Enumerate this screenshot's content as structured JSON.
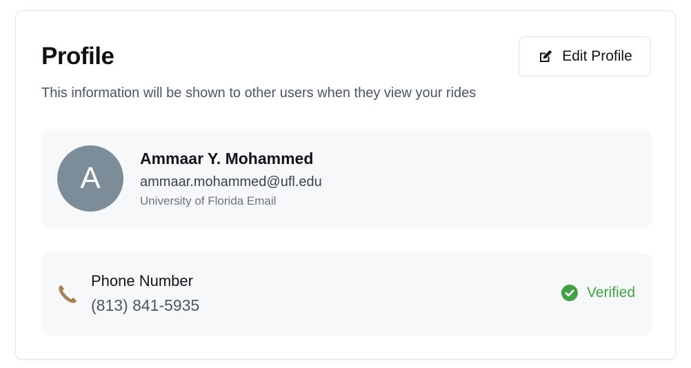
{
  "profile": {
    "title": "Profile",
    "subtitle": "This information will be shown to other users when they view your rides",
    "edit_button_label": "Edit Profile",
    "edit_icon": "edit-icon"
  },
  "user": {
    "avatar_initial": "A",
    "avatar_color": "#7c8d99",
    "name": "Ammaar Y. Mohammed",
    "email": "ammaar.mohammed@ufl.edu",
    "email_note": "University of Florida Email"
  },
  "phone": {
    "icon": "phone-icon",
    "icon_color": "#a8825a",
    "label": "Phone Number",
    "number": "(813) 841-5935",
    "status": "Verified",
    "status_color": "#43a047",
    "status_icon": "check-circle-icon"
  }
}
